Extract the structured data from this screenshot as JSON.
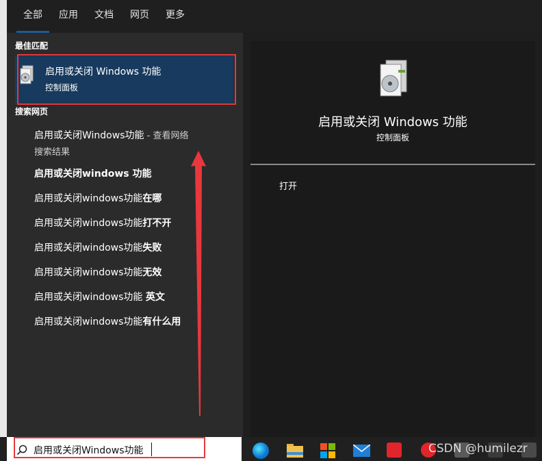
{
  "tabs": [
    "全部",
    "应用",
    "文档",
    "网页",
    "更多"
  ],
  "best_match": {
    "header": "最佳匹配",
    "title": "启用或关闭 Windows 功能",
    "subtitle": "控制面板"
  },
  "web": {
    "header": "搜索网页",
    "first_line": "启用或关闭Windows功能",
    "first_suffix": " - 查看网络",
    "first_line2": "搜索结果",
    "items": [
      {
        "prefix": "启用或关闭windows 功能",
        "bold": ""
      },
      {
        "prefix": "启用或关闭windows功能",
        "bold": "在哪"
      },
      {
        "prefix": "启用或关闭windows功能",
        "bold": "打不开"
      },
      {
        "prefix": "启用或关闭windows功能",
        "bold": "失败"
      },
      {
        "prefix": "启用或关闭windows功能",
        "bold": "无效"
      },
      {
        "prefix": "启用或关闭windows功能 ",
        "bold": "英文"
      },
      {
        "prefix": "启用或关闭windows功能",
        "bold": "有什么用"
      }
    ]
  },
  "preview": {
    "title": "启用或关闭 Windows 功能",
    "subtitle": "控制面板",
    "action_open": "打开"
  },
  "search": {
    "value": "启用或关闭Windows功能"
  },
  "watermark": "CSDN @humilezr",
  "colors": {
    "accent": "#1e5a96",
    "highlight": "#e8383d",
    "selected_bg": "#173a5e"
  }
}
